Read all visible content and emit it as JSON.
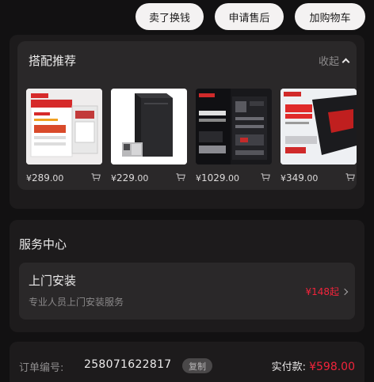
{
  "top_actions": {
    "sell_label": "卖了换钱",
    "aftersale_label": "申请售后",
    "addcart_label": "加购物车"
  },
  "recommend": {
    "title": "搭配推荐",
    "collapse_label": "收起",
    "products": [
      {
        "currency": "¥",
        "price_int": "289",
        "price_dec": ".00",
        "icon": "cart-icon"
      },
      {
        "currency": "¥",
        "price_int": "229",
        "price_dec": ".00",
        "icon": "cart-icon"
      },
      {
        "currency": "¥",
        "price_int": "1029",
        "price_dec": ".00",
        "icon": "cart-icon"
      },
      {
        "currency": "¥",
        "price_int": "349",
        "price_dec": ".00",
        "icon": "cart-icon"
      }
    ]
  },
  "service": {
    "title": "服务中心",
    "item_name": "上门安装",
    "item_desc": "专业人员上门安装服务",
    "item_price": "¥148起"
  },
  "order": {
    "no_label": "订单编号:",
    "no_value": "258071622817",
    "copy_label": "复制",
    "paid_label": "实付款: ",
    "paid_amount": "¥598.00"
  },
  "colors": {
    "background": "#121112",
    "card": "#1d1b1c",
    "inner_card": "#2a2829",
    "accent_red": "#f2243b"
  }
}
